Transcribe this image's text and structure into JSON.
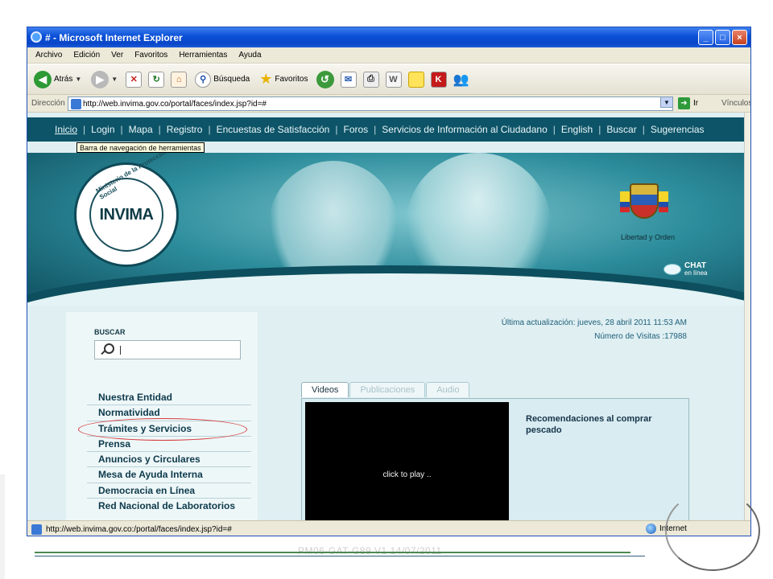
{
  "window": {
    "title": "# - Microsoft Internet Explorer"
  },
  "menubar": [
    "Archivo",
    "Edición",
    "Ver",
    "Favoritos",
    "Herramientas",
    "Ayuda"
  ],
  "toolbar": {
    "back_label": "Atrás",
    "search_label": "Búsqueda",
    "favorites_label": "Favoritos"
  },
  "address": {
    "label": "Dirección",
    "url": "http://web.invima.gov.co/portal/faces/index.jsp?id=#",
    "go_label": "Ir",
    "links_label": "Vínculos"
  },
  "nav": {
    "items": [
      "Inicio",
      "Login",
      "Mapa",
      "Registro",
      "Encuestas de Satisfacción",
      "Foros",
      "Servicios de Información al Ciudadano",
      "English",
      "Buscar",
      "Sugerencias"
    ],
    "tooltip": "Barra de navegación de herramientas"
  },
  "banner": {
    "logo_text": "INVIMA",
    "seal_top": "Ministerio de la Protección Social",
    "motto": "Libertad y Orden",
    "chat_title": "CHAT",
    "chat_sub": "en línea"
  },
  "sidebar": {
    "search_label": "BUSCAR",
    "menu": [
      "Nuestra Entidad",
      "Normatividad",
      "Trámites y Servicios",
      "Prensa",
      "Anuncios y Circulares",
      "Mesa de Ayuda Interna",
      "Democracia en Línea",
      "Red Nacional de Laboratorios"
    ]
  },
  "main": {
    "last_update": "Última actualización: jueves, 28 abril 2011 11:53 AM",
    "visits": "Número de Visitas :17988",
    "tabs": [
      "Videos",
      "Publicaciones",
      "Audio"
    ],
    "player_text": "click to play ..",
    "recommendation": "Recomendaciones al comprar pescado"
  },
  "status": {
    "url": "http://web.invima.gov.co:/portal/faces/index.jsp?id=#",
    "zone": "Internet"
  },
  "footer": {
    "code": "PM06-GAT-G89 V1 14/07/2011"
  },
  "colors": {
    "nav_bg": "#0d5468",
    "title_bar": "#0a4fd6",
    "highlight_circle": "#d43a3a"
  }
}
